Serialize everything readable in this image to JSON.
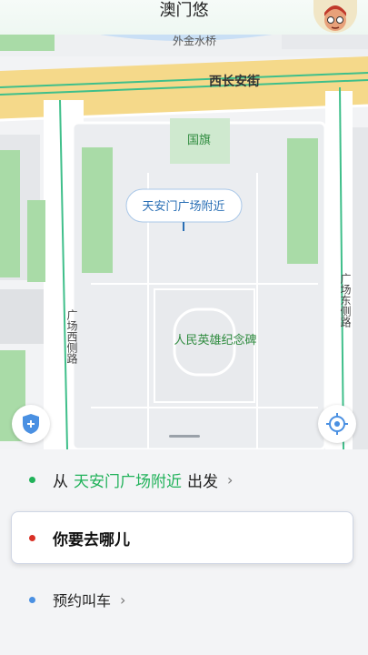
{
  "header": {
    "title": "澳门悠"
  },
  "map": {
    "labels": {
      "bridge": "外金水桥",
      "street": "西长安街",
      "flag": "国旗",
      "monument": "人民英雄纪念碑",
      "west_road": "广场西侧路",
      "east_road": "广场东侧路"
    },
    "pin_label": "天安门广场附近"
  },
  "panel": {
    "from_prefix": "从",
    "from_place": "天安门广场附近",
    "from_suffix": "出发",
    "destination_placeholder": "你要去哪儿",
    "book_label": "预约叫车"
  },
  "colors": {
    "accent": "#21b25a",
    "from_dot": "#21b25a",
    "to_dot": "#d93025",
    "book_dot": "#4a90e2",
    "road": "#f5d98a",
    "green": "#a9dba7"
  }
}
